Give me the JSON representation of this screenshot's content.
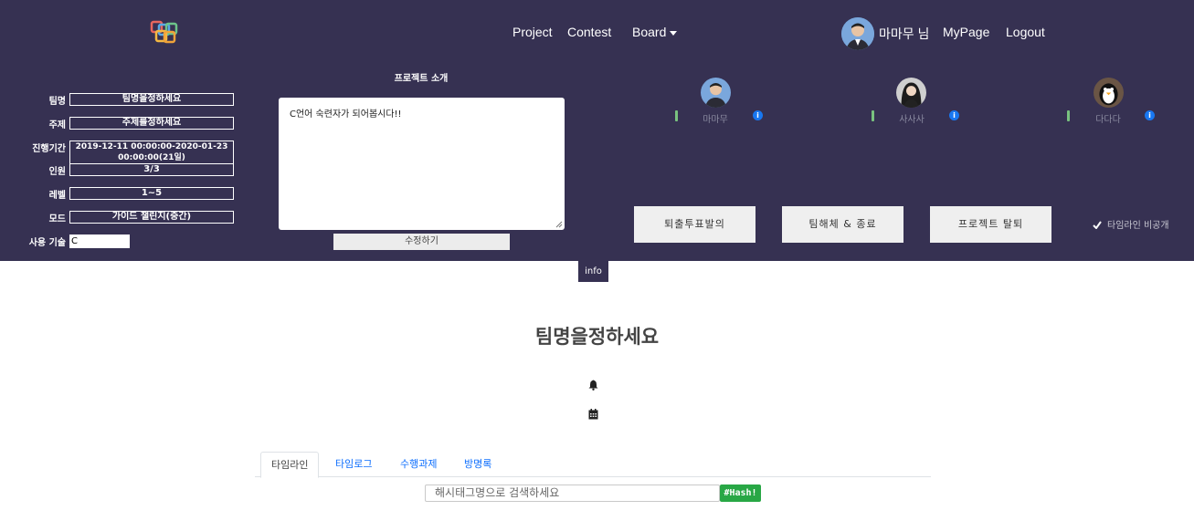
{
  "header": {
    "nav": [
      {
        "label": "Project"
      },
      {
        "label": "Contest"
      },
      {
        "label": "Board"
      }
    ],
    "user_name": "마마무 님",
    "mypage_label": "MyPage",
    "logout_label": "Logout"
  },
  "project_info": {
    "fields": [
      {
        "label": "팀명",
        "value": "팀명을정하세요"
      },
      {
        "label": "주제",
        "value": "주제를정하세요"
      },
      {
        "label": "진행기간",
        "value": "2019-12-11 00:00:00-2020-01-23 00:00:00(21일)"
      },
      {
        "label": "인원",
        "value": "3/3"
      },
      {
        "label": "레벨",
        "value": "1~5"
      },
      {
        "label": "모드",
        "value": "가이드 챌린지(중간)"
      },
      {
        "label": "사용 기술",
        "value": "C"
      }
    ],
    "intro_title": "프로젝트 소개",
    "intro_text": "C언어 숙련자가 되어봅시다!!",
    "edit_label": "수정하기"
  },
  "members": [
    {
      "name": "마마무",
      "info_icon": "info-icon"
    },
    {
      "name": "사사사",
      "info_icon": "info-icon"
    },
    {
      "name": "다다다",
      "info_icon": "info-icon"
    }
  ],
  "actions": {
    "vote_kick": "퇴출투표발의",
    "disband": "팀해체 & 종료",
    "leave": "프로젝트 탈퇴",
    "private_timeline": "타임라인 비공개"
  },
  "info_tab": "info",
  "team_title": "팀명을정하세요",
  "icons": {
    "bell": "bell-icon",
    "calendar": "calendar-icon",
    "check": "check-icon"
  },
  "tabs": [
    {
      "label": "타임라인",
      "active": true
    },
    {
      "label": "타임로그",
      "active": false
    },
    {
      "label": "수행과제",
      "active": false
    },
    {
      "label": "방명록",
      "active": false
    }
  ],
  "search": {
    "placeholder": "해시태그명으로 검색하세요",
    "button_label": "#Hash!"
  },
  "colors": {
    "header_bg": "#363152",
    "accent_blue": "#0d6efd",
    "hash_green": "#28a745"
  }
}
